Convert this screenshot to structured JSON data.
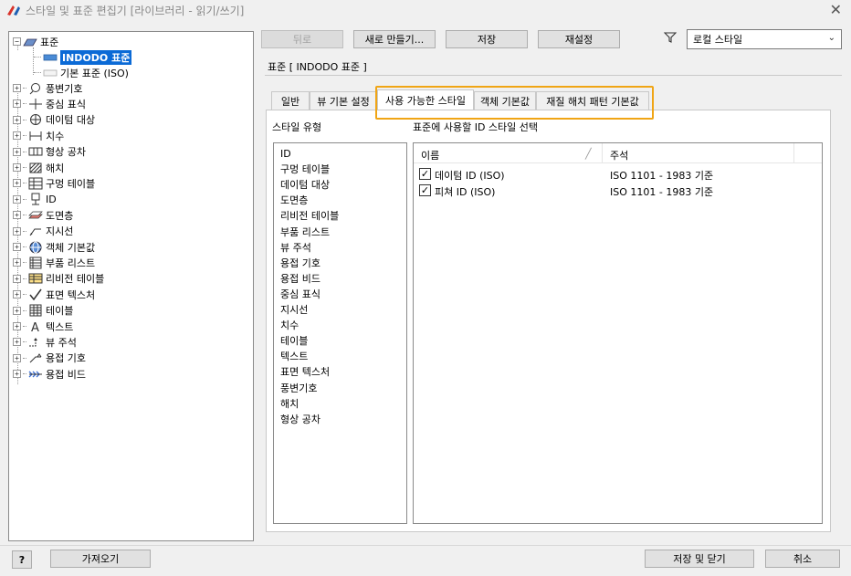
{
  "window": {
    "title": "스타일 및 표준 편집기 [라이브러리 - 읽기/쓰기]",
    "close": "✕"
  },
  "tree": {
    "root": "표준",
    "children": [
      "INDODO 표준",
      "기본 표준 (ISO)"
    ],
    "categories": [
      {
        "label": "풍변기호",
        "icon": "balloon-icon"
      },
      {
        "label": "중심 표식",
        "icon": "center-mark-icon"
      },
      {
        "label": "데이텀 대상",
        "icon": "datum-target-icon"
      },
      {
        "label": "치수",
        "icon": "dimension-icon"
      },
      {
        "label": "형상 공차",
        "icon": "feature-control-frame-icon"
      },
      {
        "label": "해치",
        "icon": "hatch-icon"
      },
      {
        "label": "구멍 테이블",
        "icon": "hole-table-icon"
      },
      {
        "label": "ID",
        "icon": "id-icon"
      },
      {
        "label": "도면층",
        "icon": "layer-icon"
      },
      {
        "label": "지시선",
        "icon": "leader-icon"
      },
      {
        "label": "객체 기본값",
        "icon": "object-defaults-icon"
      },
      {
        "label": "부품 리스트",
        "icon": "parts-list-icon"
      },
      {
        "label": "리비전 테이블",
        "icon": "revision-table-icon"
      },
      {
        "label": "표면 텍스처",
        "icon": "surface-texture-icon"
      },
      {
        "label": "테이블",
        "icon": "table-icon"
      },
      {
        "label": "텍스트",
        "icon": "text-icon"
      },
      {
        "label": "뷰 주석",
        "icon": "view-annotation-icon"
      },
      {
        "label": "용접 기호",
        "icon": "weld-symbol-icon"
      },
      {
        "label": "용접 비드",
        "icon": "weld-bead-icon"
      }
    ]
  },
  "toolbar": {
    "back": "뒤로",
    "new": "새로 만들기...",
    "save": "저장",
    "reset": "재설정",
    "filter_value": "로컬 스타일"
  },
  "section": {
    "title": "표준 [ INDODO 표준 ]"
  },
  "tabs": [
    "일반",
    "뷰 기본 설정",
    "사용 가능한 스타일",
    "객체 기본값",
    "재질 해치 패턴 기본값"
  ],
  "available": {
    "style_type_label": "스타일 유형",
    "select_label": "표준에 사용할 ID 스타일 선택",
    "style_types": [
      "ID",
      "구멍 테이블",
      "데이텀 대상",
      "도면층",
      "리비전 테이블",
      "부품 리스트",
      "뷰 주석",
      "용접 기호",
      "용접 비드",
      "중심 표식",
      "지시선",
      "치수",
      "테이블",
      "텍스트",
      "표면 텍스처",
      "풍변기호",
      "해치",
      "형상 공차"
    ],
    "columns": [
      "이름",
      "주석"
    ],
    "rows": [
      {
        "name": "데이텀 ID (ISO)",
        "note": "ISO 1101 - 1983 기준",
        "checked": true
      },
      {
        "name": "피쳐 ID (ISO)",
        "note": "ISO 1101 - 1983 기준",
        "checked": true
      }
    ]
  },
  "footer": {
    "help": "?",
    "import": "가져오기",
    "save_close": "저장 및 닫기",
    "cancel": "취소"
  },
  "colors": {
    "selection": "#0b6ad6",
    "highlight": "#f0a515"
  }
}
